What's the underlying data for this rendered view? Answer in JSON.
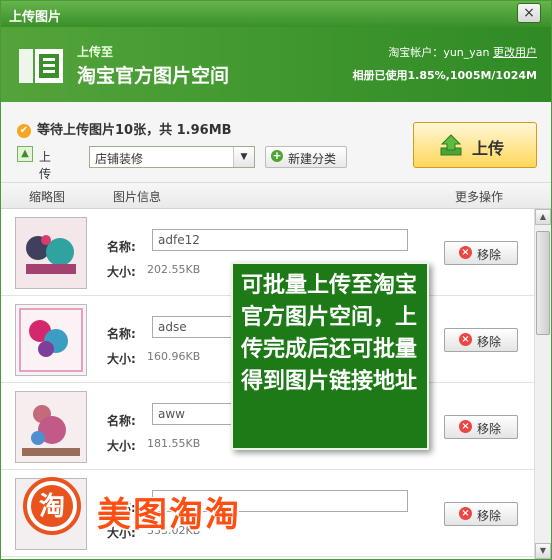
{
  "window": {
    "title": "上传图片",
    "close_glyph": "×"
  },
  "banner": {
    "upload_to": "上传至",
    "space_name": "淘宝官方图片空间",
    "account_label": "淘宝帐户：",
    "account_user": "yun_yan",
    "change_user": "更改用户",
    "usage": "相册已使用1.85%,1005M/1024M"
  },
  "info": {
    "waiting_text": "等待上传图片10张，共 1.96MB",
    "dest_label": "上传到:",
    "dest_value": "店铺装修",
    "new_category": "新建分类",
    "upload_button": "上传"
  },
  "columns": {
    "thumb": "缩略图",
    "info": "图片信息",
    "more": "更多操作"
  },
  "rows": [
    {
      "name_label": "名称:",
      "name_value": "adfe12",
      "size_label": "大小:",
      "size_value": "202.55KB",
      "remove": "移除"
    },
    {
      "name_label": "名称:",
      "name_value": "adse",
      "size_label": "大小:",
      "size_value": "160.96KB",
      "remove": "移除"
    },
    {
      "name_label": "名称:",
      "name_value": "aww",
      "size_label": "大小:",
      "size_value": "181.55KB",
      "remove": "移除"
    },
    {
      "name_label": "名称:",
      "name_value": "",
      "size_label": "大小:",
      "size_value": "333.02KB",
      "remove": "移除"
    }
  ],
  "callout": {
    "text": "可批量上传至淘宝官方图片空间，上传完成后还可批量得到图片链接地址"
  },
  "watermark": {
    "logo_char": "淘",
    "text": "美图淘淘"
  },
  "colors": {
    "brand_green": "#3b8f2a",
    "callout_green": "#1d7a16",
    "upload_yellow": "#ffd75a",
    "watermark_orange": "#ff4e12"
  },
  "icons": [
    "close-icon",
    "logo-icon",
    "check-circle-icon",
    "upload-folder-icon",
    "chevron-down-icon",
    "plus-icon",
    "upload-arrow-icon",
    "remove-icon",
    "scroll-up-icon",
    "scroll-down-icon"
  ]
}
